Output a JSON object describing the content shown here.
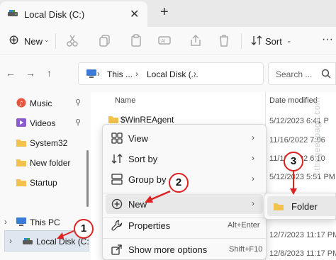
{
  "tab": {
    "title": "Local Disk (C:)",
    "close": "✕",
    "add": "+"
  },
  "toolbar": {
    "new_label": "New",
    "new_chevron": "⌄",
    "sort_label": "Sort",
    "sort_chevron": "⌄",
    "more": "···"
  },
  "nav": {
    "back": "←",
    "forward": "→",
    "up": "↑"
  },
  "breadcrumb": {
    "item1": "This ...",
    "sep": "›",
    "item2": "Local Disk (...",
    "sep2": "›"
  },
  "search": {
    "placeholder": "Search ..."
  },
  "sidebar": {
    "items": [
      {
        "label": "Music",
        "icon": "music-icon",
        "pinned": true
      },
      {
        "label": "Videos",
        "icon": "videos-icon",
        "pinned": true
      },
      {
        "label": "System32",
        "icon": "folder-icon",
        "pinned": false
      },
      {
        "label": "New folder",
        "icon": "folder-icon",
        "pinned": false
      },
      {
        "label": "Startup",
        "icon": "folder-icon",
        "pinned": false
      },
      {
        "label": "This PC",
        "icon": "computer-icon",
        "pinned": false
      },
      {
        "label": "Local Disk (C:",
        "icon": "drive-icon",
        "pinned": false
      }
    ],
    "pin_glyph": "📌",
    "expand_glyph": "›"
  },
  "content": {
    "columns": {
      "name": "Name",
      "date": "Date modified"
    },
    "rows": [
      {
        "name": "$WinREAgent",
        "date": "5/12/2023 6:41 P"
      }
    ],
    "other_dates": [
      "11/16/2022 7:06",
      "11/15/2022 6:10",
      "5/12/2023 5:51 PM",
      "5/12/2023 6:41 P",
      "12/7/2023 11:17 PM",
      "12/8/2023 11:17 PM"
    ]
  },
  "context_menu": {
    "items": [
      {
        "label": "View",
        "icon": "view-grid-icon",
        "submenu": true,
        "shortcut": ""
      },
      {
        "label": "Sort by",
        "icon": "sort-icon",
        "submenu": true,
        "shortcut": ""
      },
      {
        "label": "Group by",
        "icon": "group-icon",
        "submenu": true,
        "shortcut": ""
      },
      {
        "label": "New",
        "icon": "plus-circle-icon",
        "submenu": true,
        "shortcut": ""
      },
      {
        "label": "Properties",
        "icon": "wrench-icon",
        "submenu": false,
        "shortcut": "Alt+Enter"
      },
      {
        "label": "Show more options",
        "icon": "share-icon",
        "submenu": false,
        "shortcut": "Shift+F10"
      }
    ],
    "chevron": "›"
  },
  "submenu": {
    "folder_label": "Folder"
  },
  "callouts": [
    "1",
    "2",
    "3"
  ],
  "watermark": "©thegeekpage.com",
  "colors": {
    "folder": "#f2c14e",
    "accent_red": "#dd2222",
    "selection": "#dfe6ef"
  }
}
